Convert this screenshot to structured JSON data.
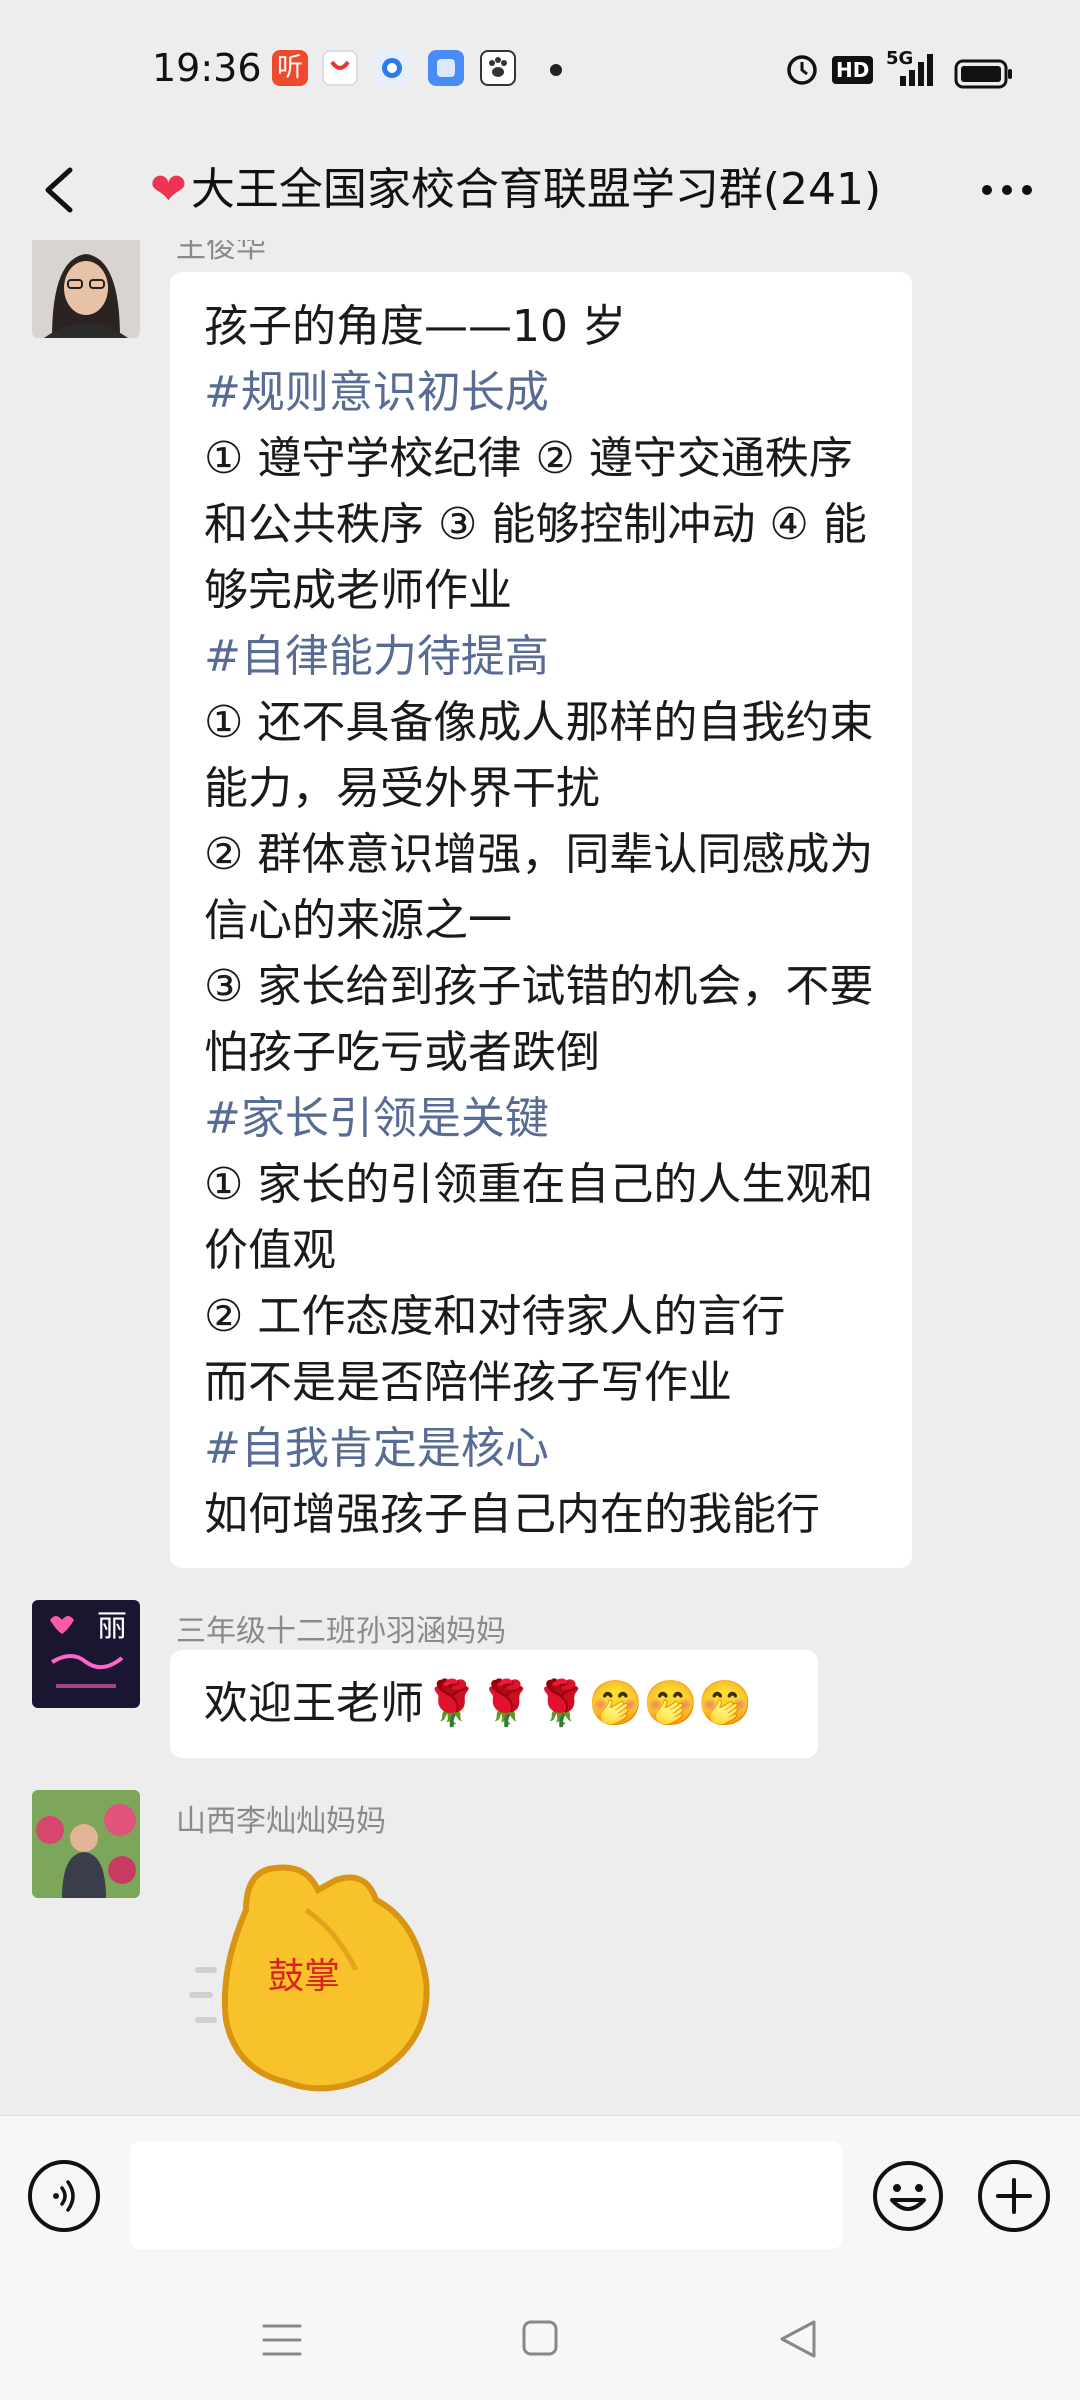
{
  "status_bar": {
    "time": "19:36",
    "app_icon_1_text": "听",
    "network": "5G",
    "hd_badge": "HD"
  },
  "header": {
    "title": "大王全国家校合育联盟学习群(241)",
    "title_emoji": "❤"
  },
  "messages": [
    {
      "sender": "王俊华",
      "lines": [
        {
          "text": "孩子的角度——10 岁",
          "tag": false
        },
        {
          "text": "#规则意识初长成",
          "tag": true
        },
        {
          "text": "① 遵守学校纪律 ② 遵守交通秩序",
          "tag": false
        },
        {
          "text": "和公共秩序 ③ 能够控制冲动 ④ 能",
          "tag": false
        },
        {
          "text": "够完成老师作业",
          "tag": false
        },
        {
          "text": "#自律能力待提高",
          "tag": true
        },
        {
          "text": "① 还不具备像成人那样的自我约束",
          "tag": false
        },
        {
          "text": "能力，易受外界干扰",
          "tag": false
        },
        {
          "text": "② 群体意识增强，同辈认同感成为",
          "tag": false
        },
        {
          "text": "信心的来源之一",
          "tag": false
        },
        {
          "text": "③ 家长给到孩子试错的机会，不要",
          "tag": false
        },
        {
          "text": "怕孩子吃亏或者跌倒",
          "tag": false
        },
        {
          "text": "#家长引领是关键",
          "tag": true
        },
        {
          "text": "① 家长的引领重在自己的人生观和",
          "tag": false
        },
        {
          "text": "价值观",
          "tag": false
        },
        {
          "text": "② 工作态度和对待家人的言行",
          "tag": false
        },
        {
          "text": "而不是是否陪伴孩子写作业",
          "tag": false
        },
        {
          "text": "#自我肯定是核心",
          "tag": true
        },
        {
          "text": "如何增强孩子自己内在的我能行",
          "tag": false
        }
      ]
    },
    {
      "sender": "三年级十二班孙羽涵妈妈",
      "text": "欢迎王老师🌹🌹🌹🤭🤭🤭",
      "avatar_text": "丽"
    },
    {
      "sender": "山西李灿灿妈妈",
      "sticker_text": "鼓掌"
    }
  ],
  "input": {
    "value": "",
    "placeholder": ""
  },
  "colors": {
    "hashtag": "#576b95",
    "background": "#ededed",
    "bubble": "#ffffff"
  }
}
